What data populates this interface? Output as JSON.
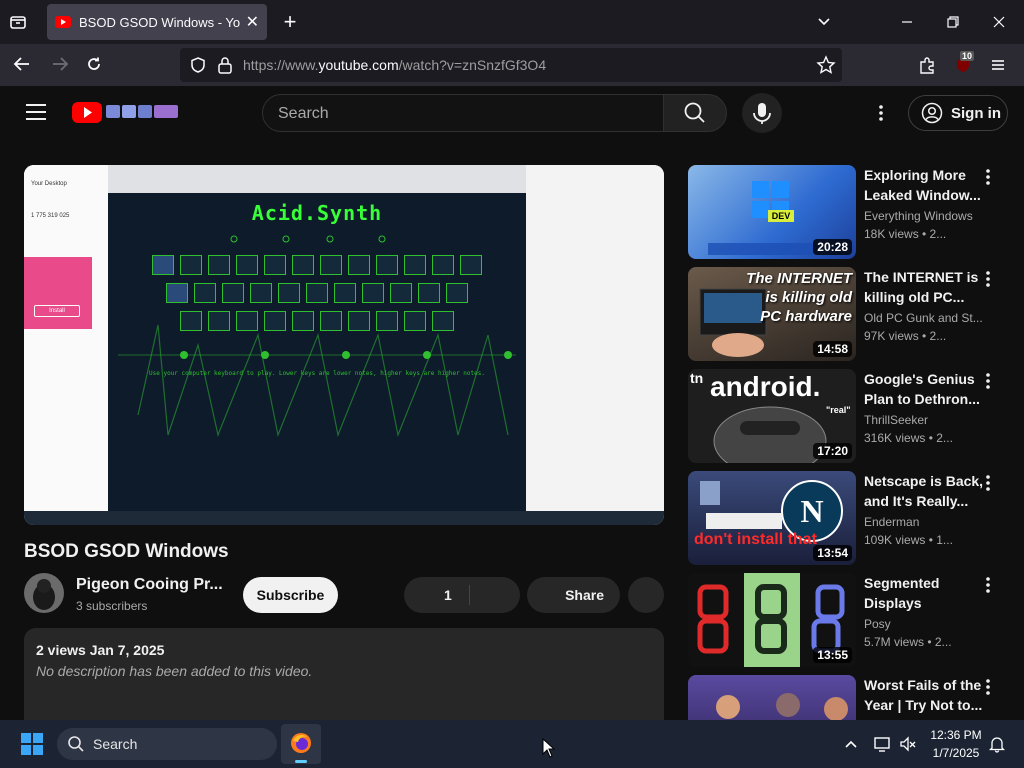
{
  "browser": {
    "tab_title": "BSOD GSOD Windows - YouTube",
    "new_tab": "+",
    "url_prefix": "https://www.",
    "url_domain": "youtube.com",
    "url_rest": "/watch?v=znSnzfGf3O4",
    "extension_badge": "10"
  },
  "youtube": {
    "logo_text": "YouTube",
    "search_placeholder": "Search",
    "sign_in_label": "Sign in"
  },
  "video": {
    "title": "BSOD GSOD Windows",
    "channel_name": "Pigeon Cooing Pr...",
    "subscribers": "3 subscribers",
    "subscribe_label": "Subscribe",
    "like_count": "1",
    "share_label": "Share",
    "stats": "2 views  Jan 7, 2025",
    "description": "No description has been added to this video.",
    "frame": {
      "synth_title": "Acid.Synth",
      "desktop_panel_title": "Your Desktop",
      "desktop_panel_value": "1 775 319 025",
      "install_label": "Install",
      "hint": "Use your computer keyboard to play. Lower keys are lower notes, higher keys are higher notes."
    }
  },
  "recommended": [
    {
      "title": "Exploring More Leaked Window...",
      "channel": "Everything Windows",
      "meta": "18K views  • 2...",
      "duration": "20:28",
      "thumb_color": "#3a7bd5"
    },
    {
      "title": "The INTERNET is killing old PC...",
      "channel": "Old PC Gunk and St...",
      "meta": "97K views  • 2...",
      "duration": "14:58",
      "thumb_color": "#5a4a3a",
      "thumb_text": [
        "The INTERNET",
        "is killing old",
        "PC hardware"
      ]
    },
    {
      "title": "Google's Genius Plan to Dethron...",
      "channel": "ThrillSeeker",
      "meta": "316K views  • 2...",
      "duration": "17:20",
      "thumb_color": "#2a2a2a",
      "thumb_text": [
        "android.",
        "\"real\""
      ]
    },
    {
      "title": "Netscape is Back, and It's Really...",
      "channel": "Enderman",
      "meta": "109K views  • 1...",
      "duration": "13:54",
      "thumb_color": "#1a1f3a",
      "thumb_text": [
        "don't install that"
      ]
    },
    {
      "title": "Segmented Displays",
      "channel": "Posy",
      "meta": "5.7M views  • 2...",
      "duration": "13:55",
      "thumb_color": "#111111"
    },
    {
      "title": "Worst Fails of the Year | Try Not to...",
      "channel": "",
      "meta": "",
      "duration": "",
      "thumb_color": "#3a2f6a"
    }
  ],
  "taskbar": {
    "search_label": "Search",
    "time": "12:36 PM",
    "date": "1/7/2025"
  }
}
